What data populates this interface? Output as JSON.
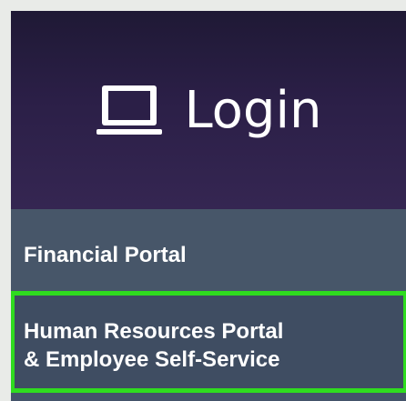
{
  "login": {
    "title": "Login",
    "icon": "monitor-icon"
  },
  "menu": {
    "items": [
      {
        "label": "Financial Portal"
      },
      {
        "label_line1": "Human Resources Portal",
        "label_line2": "& Employee Self-Service",
        "highlighted": true
      }
    ]
  },
  "colors": {
    "header_bg": "#2b1f47",
    "menu_bg": "#475669",
    "highlight_border": "#2fdc1f",
    "page_bg": "#e9ebe8"
  }
}
